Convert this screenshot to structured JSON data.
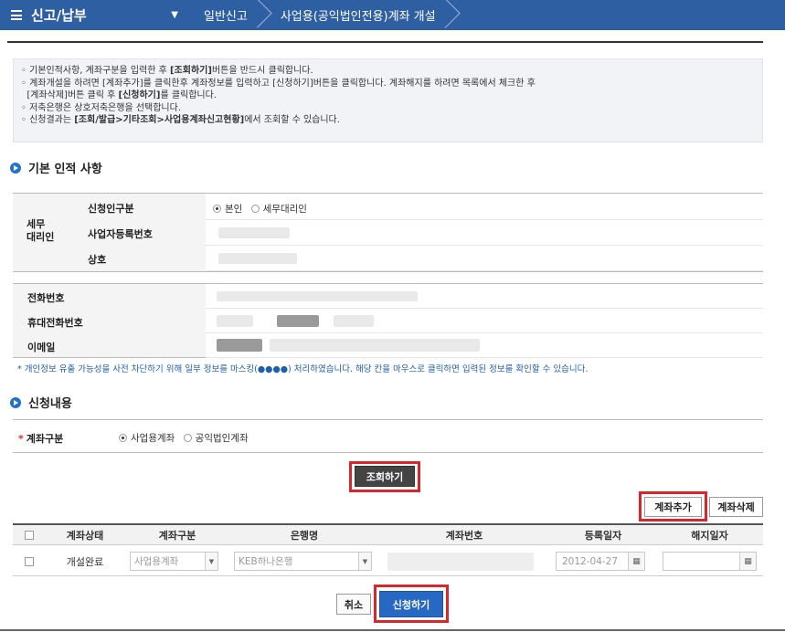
{
  "header": {
    "menu_label": "신고/납부",
    "breadcrumb": [
      "일반신고",
      "사업용(공익법인전용)계좌 개설"
    ]
  },
  "notice": {
    "line1_pre": "기본인적사항, 계좌구분을 입력한 후 ",
    "line1_bold": "[조회하기]",
    "line1_post": "버튼을 반드시 클릭합니다.",
    "line2": "계좌개설을 하려면 [계좌추가]를 클릭한후 계좌정보를 입력하고 [신청하기]버튼을 클릭합니다. 계좌해지를 하려면 목록에서 체크한 후",
    "line3_pre": "[계좌삭제]버튼 클릭 후 ",
    "line3_bold": "[신청하기]",
    "line3_post": "를 클릭합니다.",
    "line4": "저축은행은 상호저축은행을 선택합니다.",
    "line5_pre": "신청결과는 ",
    "line5_bold": "[조회/발급>기타조회>사업용계좌신고현황]",
    "line5_post": "에서 조회할 수 있습니다."
  },
  "basic": {
    "title": "기본 인적 사항",
    "agent_label": "세무\n대리인",
    "applicant_type_label": "신청인구분",
    "applicant_options": [
      "본인",
      "세무대리인"
    ],
    "bizno_label": "사업자등록번호",
    "name_label": "상호",
    "phone_label": "전화번호",
    "mobile_label": "휴대전화번호",
    "email_label": "이메일",
    "privacy_note": "* 개인정보 유출 가능성을 사전 차단하기 위해 일부 정보를 마스킹(●●●●) 처리하였습니다. 해당 칸을 마우스로 클릭하면 입력된 정보를 확인할 수 있습니다."
  },
  "request": {
    "title": "신청내용",
    "account_type_label": "계좌구분",
    "required_mark": "*",
    "account_options": [
      "사업용계좌",
      "공익법인계좌"
    ],
    "search_button": "조회하기",
    "add_button": "계좌추가",
    "delete_button": "계좌삭제"
  },
  "table": {
    "columns": [
      "계좌상태",
      "계좌구분",
      "은행명",
      "계좌번호",
      "등록일자",
      "해지일자"
    ],
    "row": {
      "status": "개설완료",
      "type": "사업용계좌",
      "bank": "KEB하나은행",
      "reg_date": "2012-04-27"
    }
  },
  "footer": {
    "cancel_button": "취소",
    "apply_button": "신청하기"
  },
  "colors": {
    "header": "#2e5fa3",
    "highlight": "#d9262a",
    "primary_button": "#2668c4"
  }
}
